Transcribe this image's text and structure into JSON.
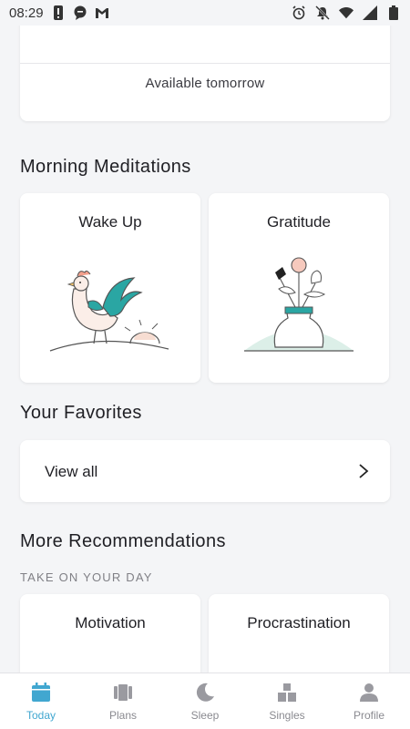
{
  "status_bar": {
    "time": "08:29",
    "left_icons": [
      "alert-icon",
      "chat-bubble-icon",
      "gmail-icon"
    ],
    "right_icons": [
      "alarm-icon",
      "mute-icon",
      "wifi-icon",
      "signal-icon",
      "battery-icon"
    ]
  },
  "top_card": {
    "available_label": "Available tomorrow"
  },
  "morning": {
    "title": "Morning Meditations",
    "tiles": [
      {
        "title": "Wake Up",
        "art": "rooster-illustration"
      },
      {
        "title": "Gratitude",
        "art": "flower-vase-illustration"
      }
    ]
  },
  "favorites": {
    "title": "Your Favorites",
    "view_all": "View all"
  },
  "recommendations": {
    "title": "More Recommendations",
    "subtitle": "TAKE ON YOUR DAY",
    "tiles": [
      {
        "title": "Motivation"
      },
      {
        "title": "Procrastination"
      }
    ]
  },
  "nav": {
    "items": [
      {
        "label": "Today",
        "icon": "calendar-icon",
        "active": true
      },
      {
        "label": "Plans",
        "icon": "cards-icon",
        "active": false
      },
      {
        "label": "Sleep",
        "icon": "moon-icon",
        "active": false
      },
      {
        "label": "Singles",
        "icon": "blocks-icon",
        "active": false
      },
      {
        "label": "Profile",
        "icon": "person-icon",
        "active": false
      }
    ]
  },
  "colors": {
    "accent": "#41a7d0",
    "teal": "#2aa6a3",
    "background": "#f4f5f7"
  }
}
